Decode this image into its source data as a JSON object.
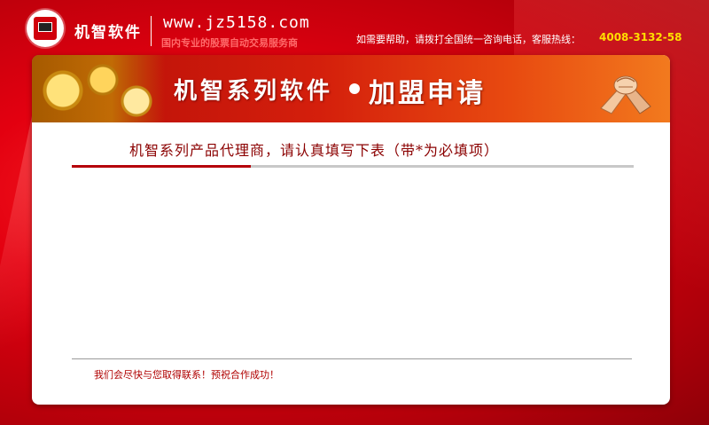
{
  "header": {
    "brand_name": "机智软件",
    "site_url": "www.jz5158.com",
    "tagline": "国内专业的股票自动交易服务商",
    "help_text": "如需要帮助，请拨打全国统一咨询电话，客服热线：",
    "hotline": "4008-3132-58"
  },
  "banner": {
    "title": "机智系列软件",
    "subtitle": "加盟申请"
  },
  "main": {
    "instruction": "机智系列产品代理商，请认真填写下表（带*为必填项）",
    "footer_message": "我们会尽快与您取得联系！预祝合作成功！"
  },
  "colors": {
    "accent_red": "#b5000a",
    "hotline_yellow": "#ffde00",
    "background_red": "#e30010"
  },
  "icons": [
    "logo-icon",
    "handshake-icon"
  ]
}
